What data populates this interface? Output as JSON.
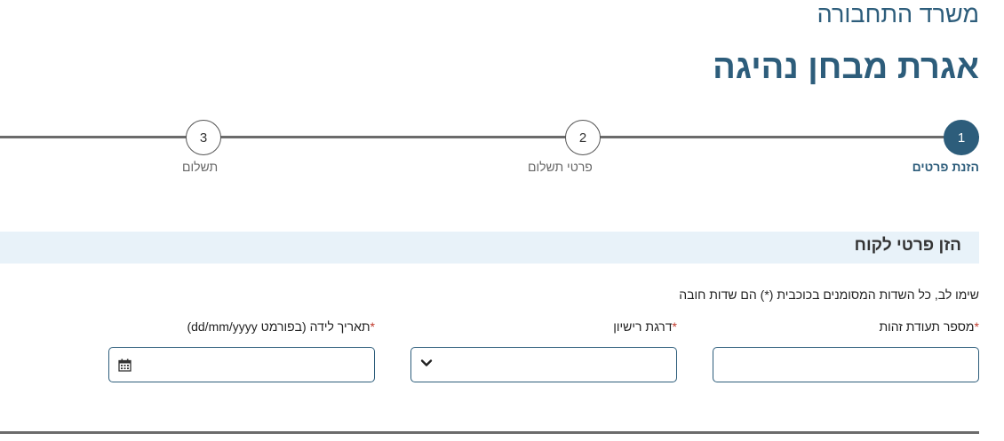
{
  "header": {
    "ministry": "משרד התחבורה",
    "title": "אגרת מבחן נהיגה"
  },
  "stepper": {
    "steps": [
      {
        "number": "1",
        "label": "הזנת פרטים",
        "active": true
      },
      {
        "number": "2",
        "label": "פרטי תשלום",
        "active": false
      },
      {
        "number": "3",
        "label": "תשלום",
        "active": false
      }
    ]
  },
  "section": {
    "title": "הזן פרטי לקוח",
    "notice": "שימו לב, כל השדות המסומנים בכוכבית (*) הם שדות חובה"
  },
  "fields": {
    "required_mark": "*",
    "id_number": {
      "label": "מספר תעודת זהות",
      "value": ""
    },
    "license_grade": {
      "label": "דרגת רישיון",
      "value": ""
    },
    "birth_date": {
      "label": "תאריך לידה (בפורמט dd/mm/yyyy)",
      "value": ""
    }
  },
  "icons": {
    "chevron": "chevron-down-icon",
    "calendar": "calendar-icon"
  },
  "colors": {
    "primary": "#2d5d7b",
    "section_bg": "#e8f2f9",
    "required": "#c0392b"
  }
}
